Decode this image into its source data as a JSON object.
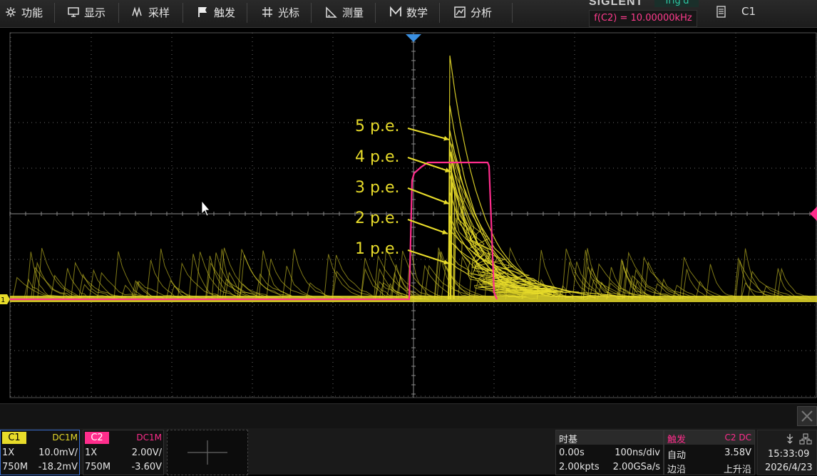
{
  "menu": {
    "items": [
      {
        "label": "功能",
        "icon": "function-icon"
      },
      {
        "label": "显示",
        "icon": "display-icon"
      },
      {
        "label": "采样",
        "icon": "acquire-icon"
      },
      {
        "label": "触发",
        "icon": "trigger-flag-icon"
      },
      {
        "label": "光标",
        "icon": "cursor-icon"
      },
      {
        "label": "测量",
        "icon": "measure-icon"
      },
      {
        "label": "数学",
        "icon": "math-icon"
      },
      {
        "label": "分析",
        "icon": "analyze-icon"
      }
    ],
    "brand": "SIGLENT",
    "trig_status": "Trig'd",
    "frequency_readout": "f(C2) = 10.00000kHz",
    "channel_select": "C1"
  },
  "annotations": [
    "5 p.e.",
    "4 p.e.",
    "3 p.e.",
    "2 p.e.",
    "1 p.e."
  ],
  "channel_marker": "1",
  "colors": {
    "ch1": "#e8dc2a",
    "ch2": "#ff2d8c",
    "trigger_marker": "#3b8fe0",
    "grid": "#6a6a6a",
    "background": "#000000"
  },
  "channels": [
    {
      "id": "C1",
      "coupling": "DC1M",
      "probe": "1X",
      "scale": "10.0mV/",
      "bandwidth": "750M",
      "offset": "-18.2mV",
      "color": "#e8dc2a"
    },
    {
      "id": "C2",
      "coupling": "DC1M",
      "probe": "1X",
      "scale": "2.00V/",
      "bandwidth": "750M",
      "offset": "-3.60V",
      "color": "#ff2d8c"
    }
  ],
  "timebase": {
    "title": "时基",
    "delay": "0.00s",
    "scale": "100ns/div",
    "points": "2.00kpts",
    "rate": "2.00GSa/s"
  },
  "trigger": {
    "title": "触发",
    "source": "C2 DC",
    "mode": "自动",
    "level": "3.58V",
    "type": "边沿",
    "slope": "上升沿"
  },
  "clock": {
    "time": "15:33:09",
    "date": "2026/4/23"
  }
}
